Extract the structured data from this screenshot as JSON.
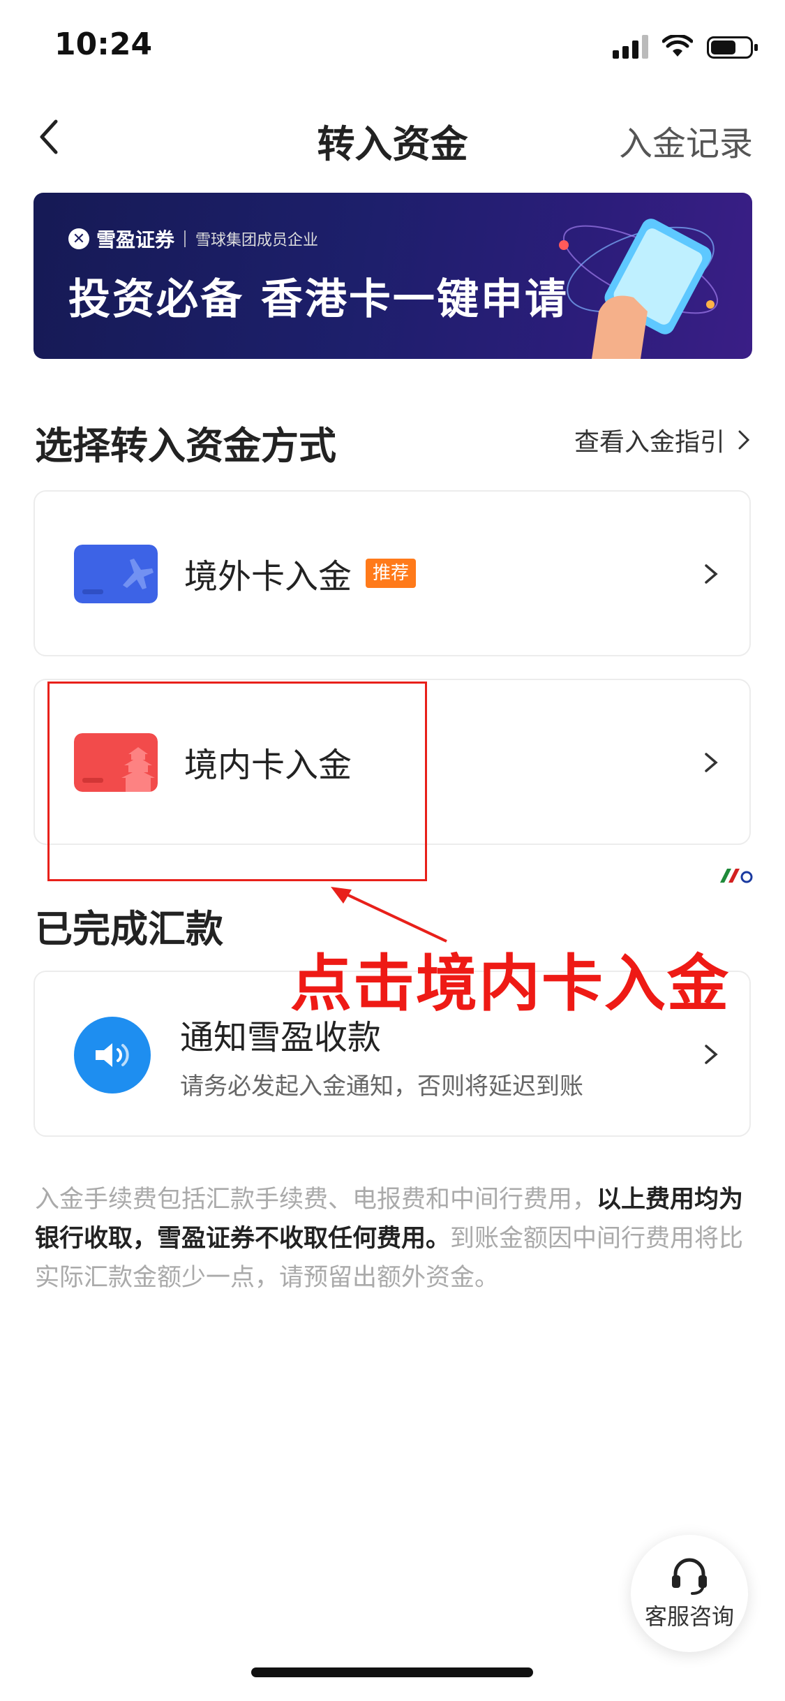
{
  "status_bar": {
    "time": "10:24",
    "battery_level": 0.65
  },
  "nav": {
    "title": "转入资金",
    "right_link": "入金记录"
  },
  "banner": {
    "brand": "雪盈证券",
    "brand_sub": "雪球集团成员企业",
    "headline": "投资必备 香港卡一键申请"
  },
  "section": {
    "title": "选择转入资金方式",
    "link": "查看入金指引"
  },
  "methods": [
    {
      "label": "境外卡入金",
      "tag": "推荐",
      "icon": "plane-card-icon",
      "color": "#3d63e6"
    },
    {
      "label": "境内卡入金",
      "tag": "",
      "icon": "temple-card-icon",
      "color": "#f24b4b"
    }
  ],
  "completed": {
    "title": "已完成汇款",
    "notify_title": "通知雪盈收款",
    "notify_sub": "请务必发起入金通知，否则将延迟到账"
  },
  "footnote": {
    "part1": "入金手续费包括汇款手续费、电报费和中间行费用，",
    "part2_bold": "以上费用均为银行收取，雪盈证券不收取任何费用。",
    "part3": "到账金额因中间行费用将比实际汇款金额少一点，请预留出额外资金。"
  },
  "annotation": {
    "text": "点击境内卡入金",
    "color": "#ee1a15"
  },
  "service": {
    "label": "客服咨询"
  }
}
